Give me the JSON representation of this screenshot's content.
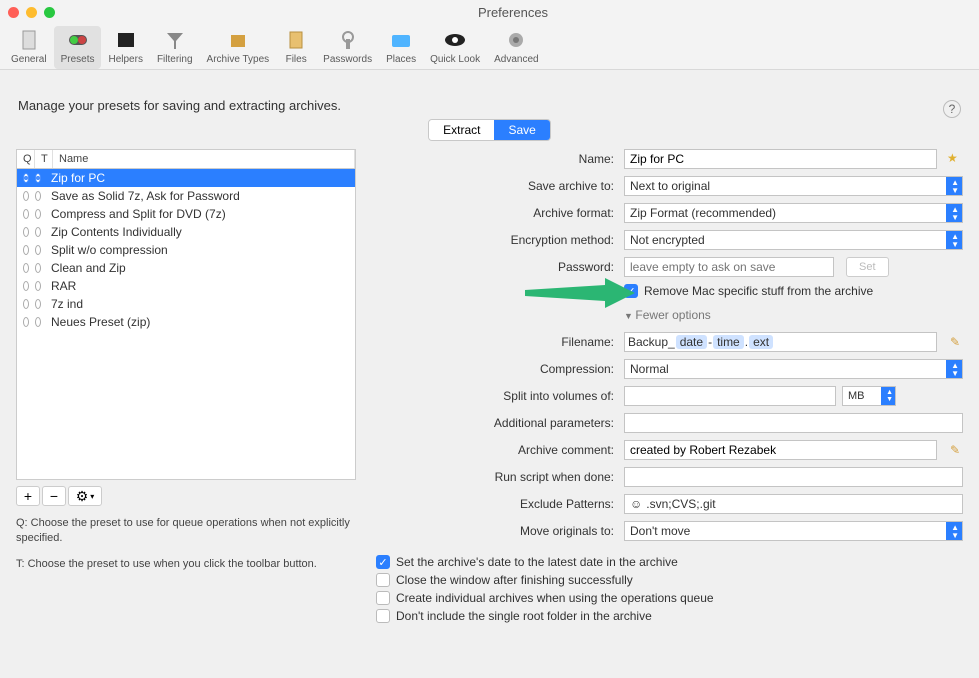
{
  "window": {
    "title": "Preferences"
  },
  "toolbar": [
    {
      "label": "General",
      "name": "general"
    },
    {
      "label": "Presets",
      "name": "presets",
      "active": true
    },
    {
      "label": "Helpers",
      "name": "helpers"
    },
    {
      "label": "Filtering",
      "name": "filtering"
    },
    {
      "label": "Archive Types",
      "name": "archive-types"
    },
    {
      "label": "Files",
      "name": "files"
    },
    {
      "label": "Passwords",
      "name": "passwords"
    },
    {
      "label": "Places",
      "name": "places"
    },
    {
      "label": "Quick Look",
      "name": "quick-look"
    },
    {
      "label": "Advanced",
      "name": "advanced"
    }
  ],
  "heading": "Manage your presets for saving and extracting archives.",
  "tabs": {
    "extract": "Extract",
    "save": "Save"
  },
  "list_headers": {
    "q": "Q",
    "t": "T",
    "name": "Name"
  },
  "presets": [
    {
      "name": "Zip for PC",
      "q": true,
      "t": true,
      "selected": true
    },
    {
      "name": "Save as Solid 7z, Ask for Password"
    },
    {
      "name": "Compress and Split for DVD (7z)"
    },
    {
      "name": "Zip Contents Individually"
    },
    {
      "name": "Split w/o compression"
    },
    {
      "name": "Clean and Zip"
    },
    {
      "name": "RAR"
    },
    {
      "name": "7z ind"
    },
    {
      "name": "Neues Preset (zip)"
    }
  ],
  "notes": {
    "q": "Q: Choose the preset to use for queue operations when not explicitly specified.",
    "t": "T: Choose the preset to use when you click the toolbar button."
  },
  "form": {
    "name_label": "Name:",
    "name_value": "Zip for PC",
    "save_to_label": "Save archive to:",
    "save_to_value": "Next to original",
    "format_label": "Archive format:",
    "format_value": "Zip Format (recommended)",
    "encryption_label": "Encryption method:",
    "encryption_value": "Not encrypted",
    "password_label": "Password:",
    "password_placeholder": "leave empty to ask on save",
    "set_label": "Set",
    "remove_mac_label": "Remove Mac specific stuff from the archive",
    "fewer_label": "Fewer options",
    "filename_label": "Filename:",
    "filename_prefix": "Backup_",
    "filename_t_date": "date",
    "filename_sep": " - ",
    "filename_t_time": "time",
    "filename_dot": " .",
    "filename_t_ext": "ext",
    "compression_label": "Compression:",
    "compression_value": "Normal",
    "split_label": "Split into volumes of:",
    "split_unit": "MB",
    "addparams_label": "Additional parameters:",
    "comment_label": "Archive comment:",
    "comment_value": "created by Robert Rezabek",
    "script_label": "Run script when done:",
    "exclude_label": "Exclude Patterns:",
    "exclude_value": ".svn;CVS;.git",
    "move_label": "Move originals to:",
    "move_value": "Don't move"
  },
  "bottom_checks": [
    {
      "label": "Set the archive's date to the latest date in the archive",
      "checked": true
    },
    {
      "label": "Close the window after finishing successfully",
      "checked": false
    },
    {
      "label": "Create individual archives when using the operations queue",
      "checked": false
    },
    {
      "label": "Don't include the single root folder in the archive",
      "checked": false
    }
  ]
}
